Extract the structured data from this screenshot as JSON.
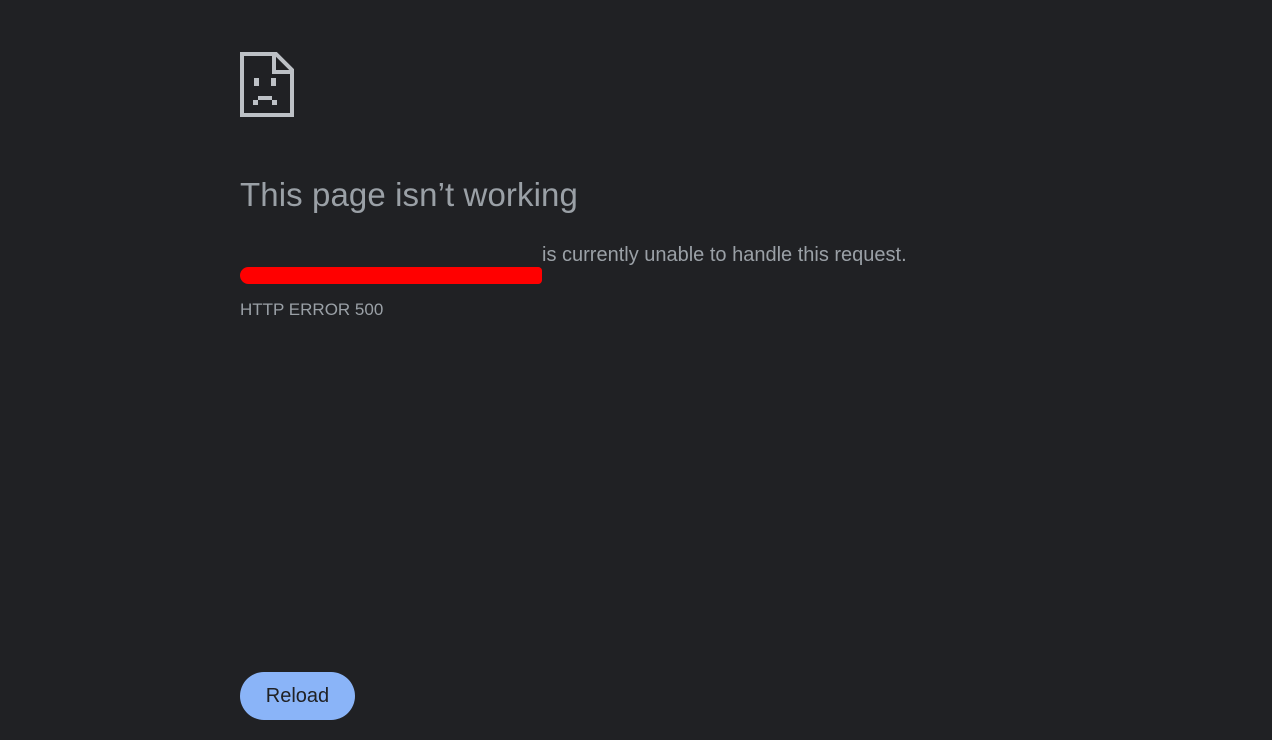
{
  "page": {
    "title": "This page isn’t working",
    "message_suffix": "is currently unable to handle this request.",
    "error_code": "HTTP ERROR 500",
    "reload_label": "Reload"
  },
  "icons": {
    "error_page": "sad-page-icon"
  },
  "colors": {
    "background": "#202124",
    "text": "#9aa0a6",
    "button": "#8ab4f8",
    "redaction": "#ff0000"
  }
}
